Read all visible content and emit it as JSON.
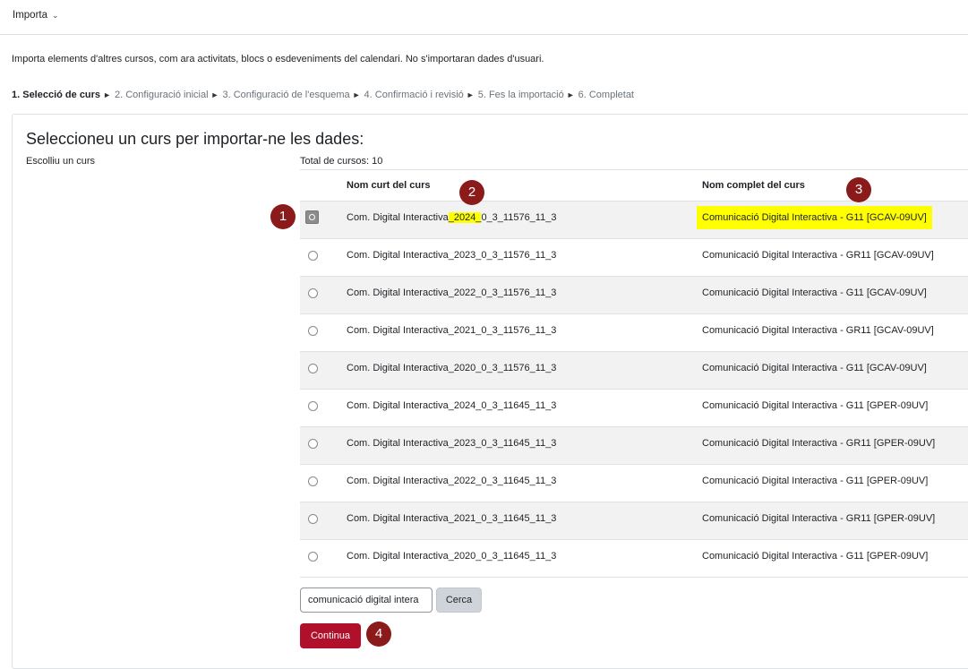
{
  "menu": {
    "label": "Importa"
  },
  "intro": "Importa elements d'altres cursos, com ara activitats, blocs o esdeveniments del calendari. No s'importaran dades d'usuari.",
  "steps": [
    "1. Selecció de curs",
    "2. Configuració inicial",
    "3. Configuració de l'esquema",
    "4. Confirmació i revisió",
    "5. Fes la importació",
    "6. Completat"
  ],
  "card": {
    "title": "Seleccioneu un curs per importar-ne les dades:",
    "choose_label": "Escolliu un curs",
    "total": "Total de cursos: 10"
  },
  "table": {
    "headers": {
      "short": "Nom curt del curs",
      "full": "Nom complet del curs"
    },
    "rows": [
      {
        "short_pre": "Com. Digital Interactiva",
        "short_hl": "_2024_",
        "short_post": "0_3_11576_11_3",
        "full": "Comunicació Digital Interactiva - G11 [GCAV-09UV]",
        "selected": true
      },
      {
        "short": "Com. Digital Interactiva_2023_0_3_11576_11_3",
        "full": "Comunicació Digital Interactiva - GR11 [GCAV-09UV]"
      },
      {
        "short": "Com. Digital Interactiva_2022_0_3_11576_11_3",
        "full": "Comunicació Digital Interactiva - G11 [GCAV-09UV]"
      },
      {
        "short": "Com. Digital Interactiva_2021_0_3_11576_11_3",
        "full": "Comunicació Digital Interactiva - GR11 [GCAV-09UV]"
      },
      {
        "short": "Com. Digital Interactiva_2020_0_3_11576_11_3",
        "full": "Comunicació Digital Interactiva - G11 [GCAV-09UV]"
      },
      {
        "short": "Com. Digital Interactiva_2024_0_3_11645_11_3",
        "full": "Comunicació Digital Interactiva - G11 [GPER-09UV]"
      },
      {
        "short": "Com. Digital Interactiva_2023_0_3_11645_11_3",
        "full": "Comunicació Digital Interactiva - GR11 [GPER-09UV]"
      },
      {
        "short": "Com. Digital Interactiva_2022_0_3_11645_11_3",
        "full": "Comunicació Digital Interactiva - G11 [GPER-09UV]"
      },
      {
        "short": "Com. Digital Interactiva_2021_0_3_11645_11_3",
        "full": "Comunicació Digital Interactiva - GR11 [GPER-09UV]"
      },
      {
        "short": "Com. Digital Interactiva_2020_0_3_11645_11_3",
        "full": "Comunicació Digital Interactiva - G11 [GPER-09UV]"
      }
    ]
  },
  "search": {
    "value": "comunicació digital intera",
    "button": "Cerca"
  },
  "continue_label": "Continua",
  "badges": [
    "1",
    "2",
    "3",
    "4"
  ],
  "colors": {
    "badge": "#8b1a1a",
    "highlight": "#ffff00",
    "primary": "#b0102a"
  }
}
